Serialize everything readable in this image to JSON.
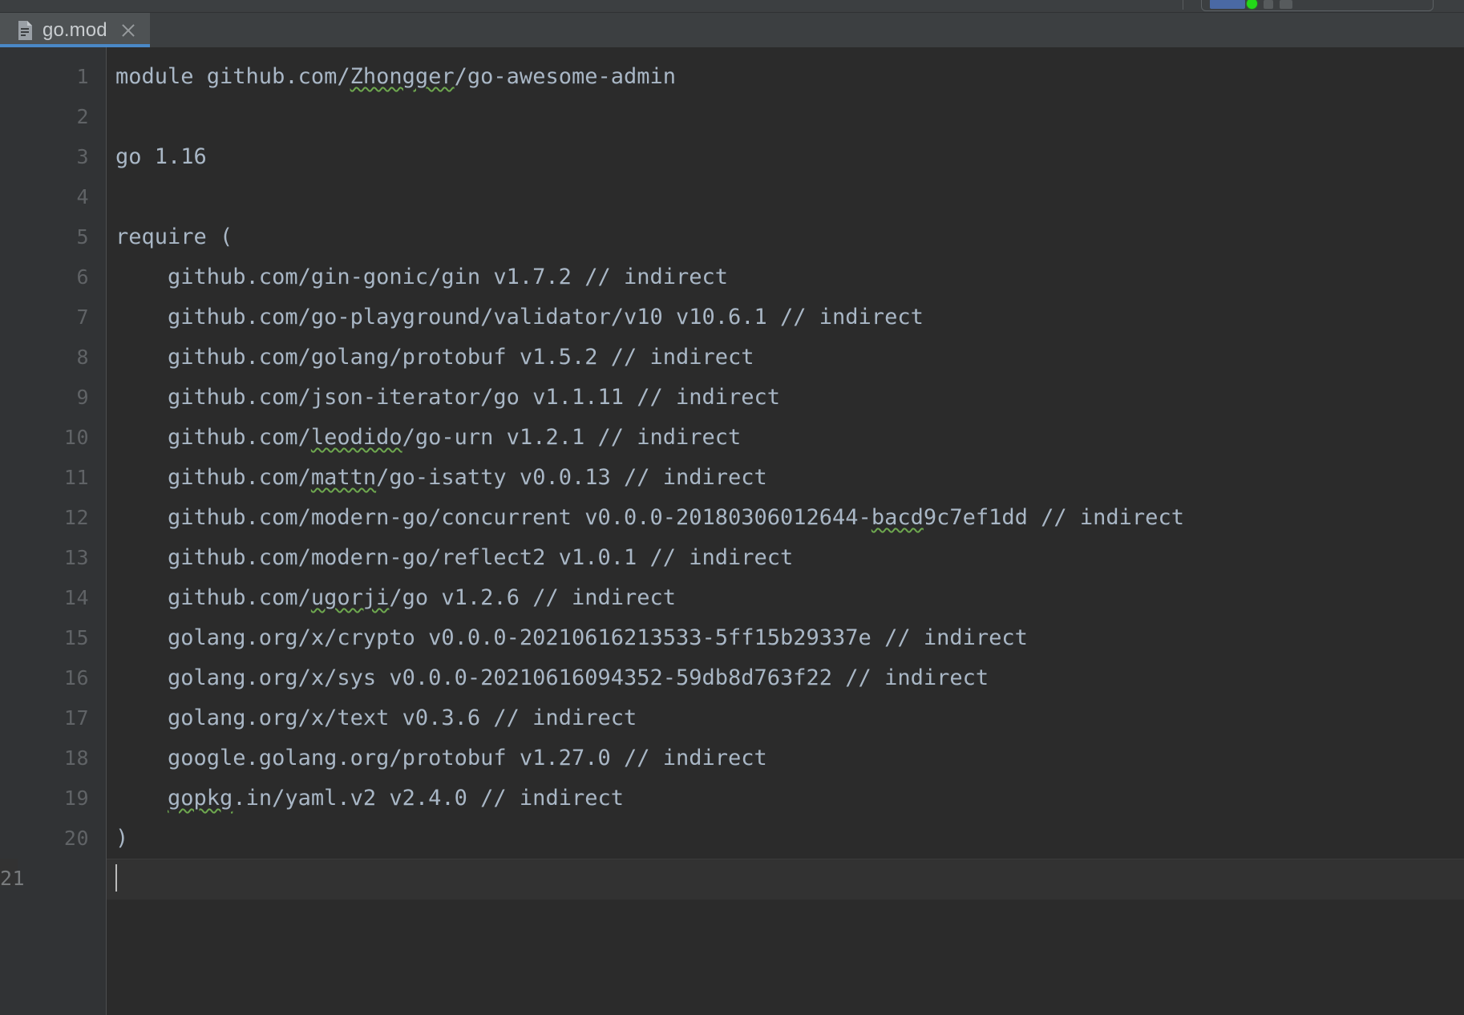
{
  "window": {
    "background_color": "#2b2b2b",
    "chrome_color": "#3c3f41"
  },
  "toolbar": {
    "run_widget_present": true,
    "run_indicator_name": "run-status-green-dot",
    "run_indicator_color": "#23d718"
  },
  "tabs": [
    {
      "label": "go.mod",
      "icon": "go-module-file-icon",
      "active": true,
      "close_label": "×",
      "active_underline_color": "#4a88c7"
    }
  ],
  "editor": {
    "language": "go-mod",
    "font": "monospace",
    "text_color": "#a9b7c6",
    "gutter_color": "#313335",
    "line_number_color": "#606366",
    "spellcheck_underline_color": "#6ea84f",
    "caret_line": 21,
    "caret_column": 1,
    "total_lines_visible": 21,
    "lines": [
      {
        "n": 1,
        "segments": [
          {
            "t": "module github.com/"
          },
          {
            "t": "Zhongger",
            "spell": true
          },
          {
            "t": "/go-awesome-admin"
          }
        ]
      },
      {
        "n": 2,
        "segments": [
          {
            "t": ""
          }
        ]
      },
      {
        "n": 3,
        "segments": [
          {
            "t": "go 1.16"
          }
        ]
      },
      {
        "n": 4,
        "segments": [
          {
            "t": ""
          }
        ]
      },
      {
        "n": 5,
        "segments": [
          {
            "t": "require ("
          }
        ]
      },
      {
        "n": 6,
        "segments": [
          {
            "t": "    github.com/gin-gonic/gin v1.7.2 // indirect"
          }
        ]
      },
      {
        "n": 7,
        "segments": [
          {
            "t": "    github.com/go-playground/validator/v10 v10.6.1 // indirect"
          }
        ]
      },
      {
        "n": 8,
        "segments": [
          {
            "t": "    github.com/golang/protobuf v1.5.2 // indirect"
          }
        ]
      },
      {
        "n": 9,
        "segments": [
          {
            "t": "    github.com/json-iterator/go v1.1.11 // indirect"
          }
        ]
      },
      {
        "n": 10,
        "segments": [
          {
            "t": "    github.com/"
          },
          {
            "t": "leodido",
            "spell": true
          },
          {
            "t": "/go-urn v1.2.1 // indirect"
          }
        ]
      },
      {
        "n": 11,
        "segments": [
          {
            "t": "    github.com/"
          },
          {
            "t": "mattn",
            "spell": true
          },
          {
            "t": "/go-isatty v0.0.13 // indirect"
          }
        ]
      },
      {
        "n": 12,
        "segments": [
          {
            "t": "    github.com/modern-go/concurrent v0.0.0-20180306012644-"
          },
          {
            "t": "bacd",
            "spell": true
          },
          {
            "t": "9c7ef1dd // indirect"
          }
        ]
      },
      {
        "n": 13,
        "segments": [
          {
            "t": "    github.com/modern-go/reflect2 v1.0.1 // indirect"
          }
        ]
      },
      {
        "n": 14,
        "segments": [
          {
            "t": "    github.com/"
          },
          {
            "t": "ugorji",
            "spell": true
          },
          {
            "t": "/go v1.2.6 // indirect"
          }
        ]
      },
      {
        "n": 15,
        "segments": [
          {
            "t": "    golang.org/x/crypto v0.0.0-20210616213533-5ff15b29337e // indirect"
          }
        ]
      },
      {
        "n": 16,
        "segments": [
          {
            "t": "    golang.org/x/sys v0.0.0-20210616094352-59db8d763f22 // indirect"
          }
        ]
      },
      {
        "n": 17,
        "segments": [
          {
            "t": "    golang.org/x/text v0.3.6 // indirect"
          }
        ]
      },
      {
        "n": 18,
        "segments": [
          {
            "t": "    google.golang.org/protobuf v1.27.0 // indirect"
          }
        ]
      },
      {
        "n": 19,
        "segments": [
          {
            "t": "    "
          },
          {
            "t": "gopkg",
            "spell": true
          },
          {
            "t": ".in/yaml.v2 v2.4.0 // indirect"
          }
        ]
      },
      {
        "n": 20,
        "segments": [
          {
            "t": ")"
          }
        ]
      },
      {
        "n": 21,
        "segments": [
          {
            "t": ""
          }
        ]
      }
    ]
  }
}
